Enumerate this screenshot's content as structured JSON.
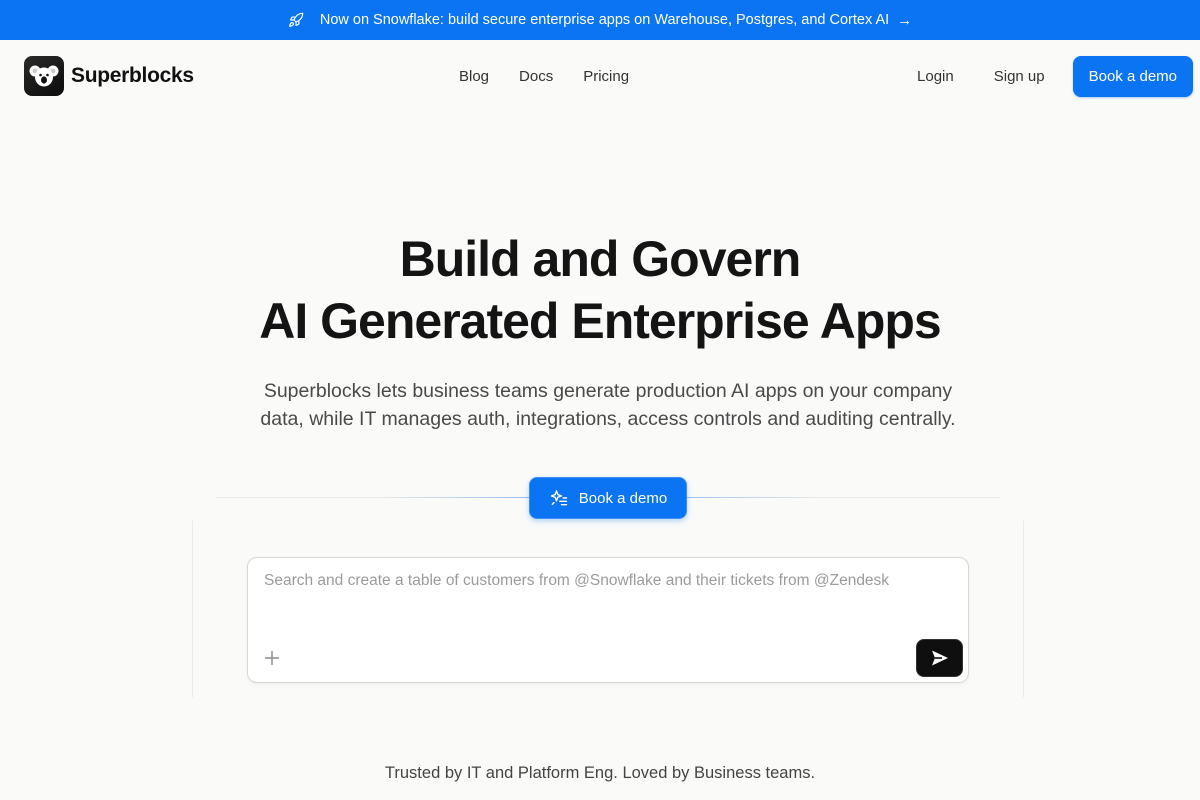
{
  "announcement": {
    "text": "Now on Snowflake: build secure enterprise apps on Warehouse, Postgres, and Cortex AI",
    "arrow": "→"
  },
  "nav": {
    "brand": "Superblocks",
    "links": [
      "Blog",
      "Docs",
      "Pricing"
    ],
    "login": "Login",
    "signup": "Sign up",
    "cta": "Book a demo"
  },
  "hero": {
    "title_line1": "Build and Govern",
    "title_line2": "AI Generated Enterprise Apps",
    "subtitle_line1": "Superblocks lets business teams generate production AI apps on your company",
    "subtitle_line2": "data, while IT manages auth, integrations, access controls and auditing centrally."
  },
  "demo_button": {
    "label": "Book a demo"
  },
  "prompt": {
    "placeholder": "Search and create a table of customers from @Snowflake and their tickets from @Zendesk",
    "value": ""
  },
  "trusted": "Trusted by IT and Platform Eng. Loved by Business teams.",
  "colors": {
    "accent": "#0a74f2",
    "background": "#fafaf9",
    "send_button": "#0f0f0f"
  },
  "icons": {
    "announcement": "rocket-icon",
    "demo": "sparkle-icon",
    "attach": "plus-icon",
    "send": "send-icon",
    "logo": "koala-logo-icon"
  }
}
